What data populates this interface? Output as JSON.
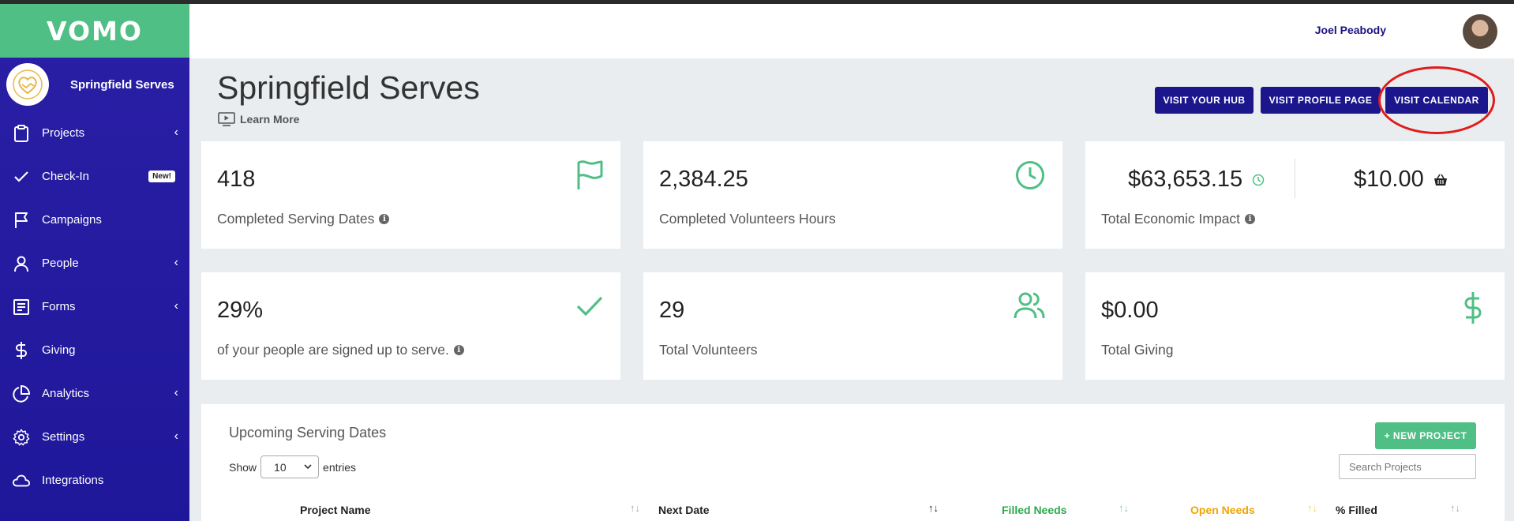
{
  "brand": {
    "logo": "VOMO",
    "color_green": "#4fbf85",
    "color_primary": "#1c168d"
  },
  "org": {
    "name": "Springfield Serves",
    "avatar_icon": "handshake-heart-icon"
  },
  "nav": [
    {
      "label": "Projects",
      "icon": "clipboard-icon",
      "chevron": "‹"
    },
    {
      "label": "Check-In",
      "icon": "check-icon",
      "badge": "New!"
    },
    {
      "label": "Campaigns",
      "icon": "flag-icon"
    },
    {
      "label": "People",
      "icon": "user-icon",
      "chevron": "‹"
    },
    {
      "label": "Forms",
      "icon": "form-icon",
      "chevron": "‹"
    },
    {
      "label": "Giving",
      "icon": "dollar-icon"
    },
    {
      "label": "Analytics",
      "icon": "pie-chart-icon",
      "chevron": "‹"
    },
    {
      "label": "Settings",
      "icon": "gear-icon",
      "chevron": "‹"
    },
    {
      "label": "Integrations",
      "icon": "cloud-icon"
    }
  ],
  "header": {
    "user_name": "Joel Peabody"
  },
  "page": {
    "title": "Springfield Serves",
    "learn_more": "Learn More",
    "buttons": {
      "hub": "VISIT YOUR HUB",
      "profile": "VISIT PROFILE PAGE",
      "calendar": "VISIT CALENDAR"
    }
  },
  "stats": {
    "serving_dates": {
      "value": "418",
      "label": "Completed Serving Dates"
    },
    "hours": {
      "value": "2,384.25",
      "label": "Completed Volunteers Hours"
    },
    "impact": {
      "value": "$63,653.15",
      "value2": "$10.00",
      "label": "Total Economic Impact"
    },
    "signed_up": {
      "value": "29%",
      "label": "of your people are signed up to serve."
    },
    "volunteers": {
      "value": "29",
      "label": "Total Volunteers"
    },
    "giving": {
      "value": "$0.00",
      "label": "Total Giving"
    }
  },
  "table": {
    "title": "Upcoming Serving Dates",
    "new_project": "+ NEW PROJECT",
    "show_label": "Show",
    "entries_value": "10",
    "entries_label": "entries",
    "search_placeholder": "Search Projects",
    "columns": [
      "Project Name",
      "Next Date",
      "Filled Needs",
      "Open Needs",
      "% Filled"
    ],
    "column_colors": {
      "filled": "#2fa84f",
      "open": "#f0a500"
    }
  }
}
